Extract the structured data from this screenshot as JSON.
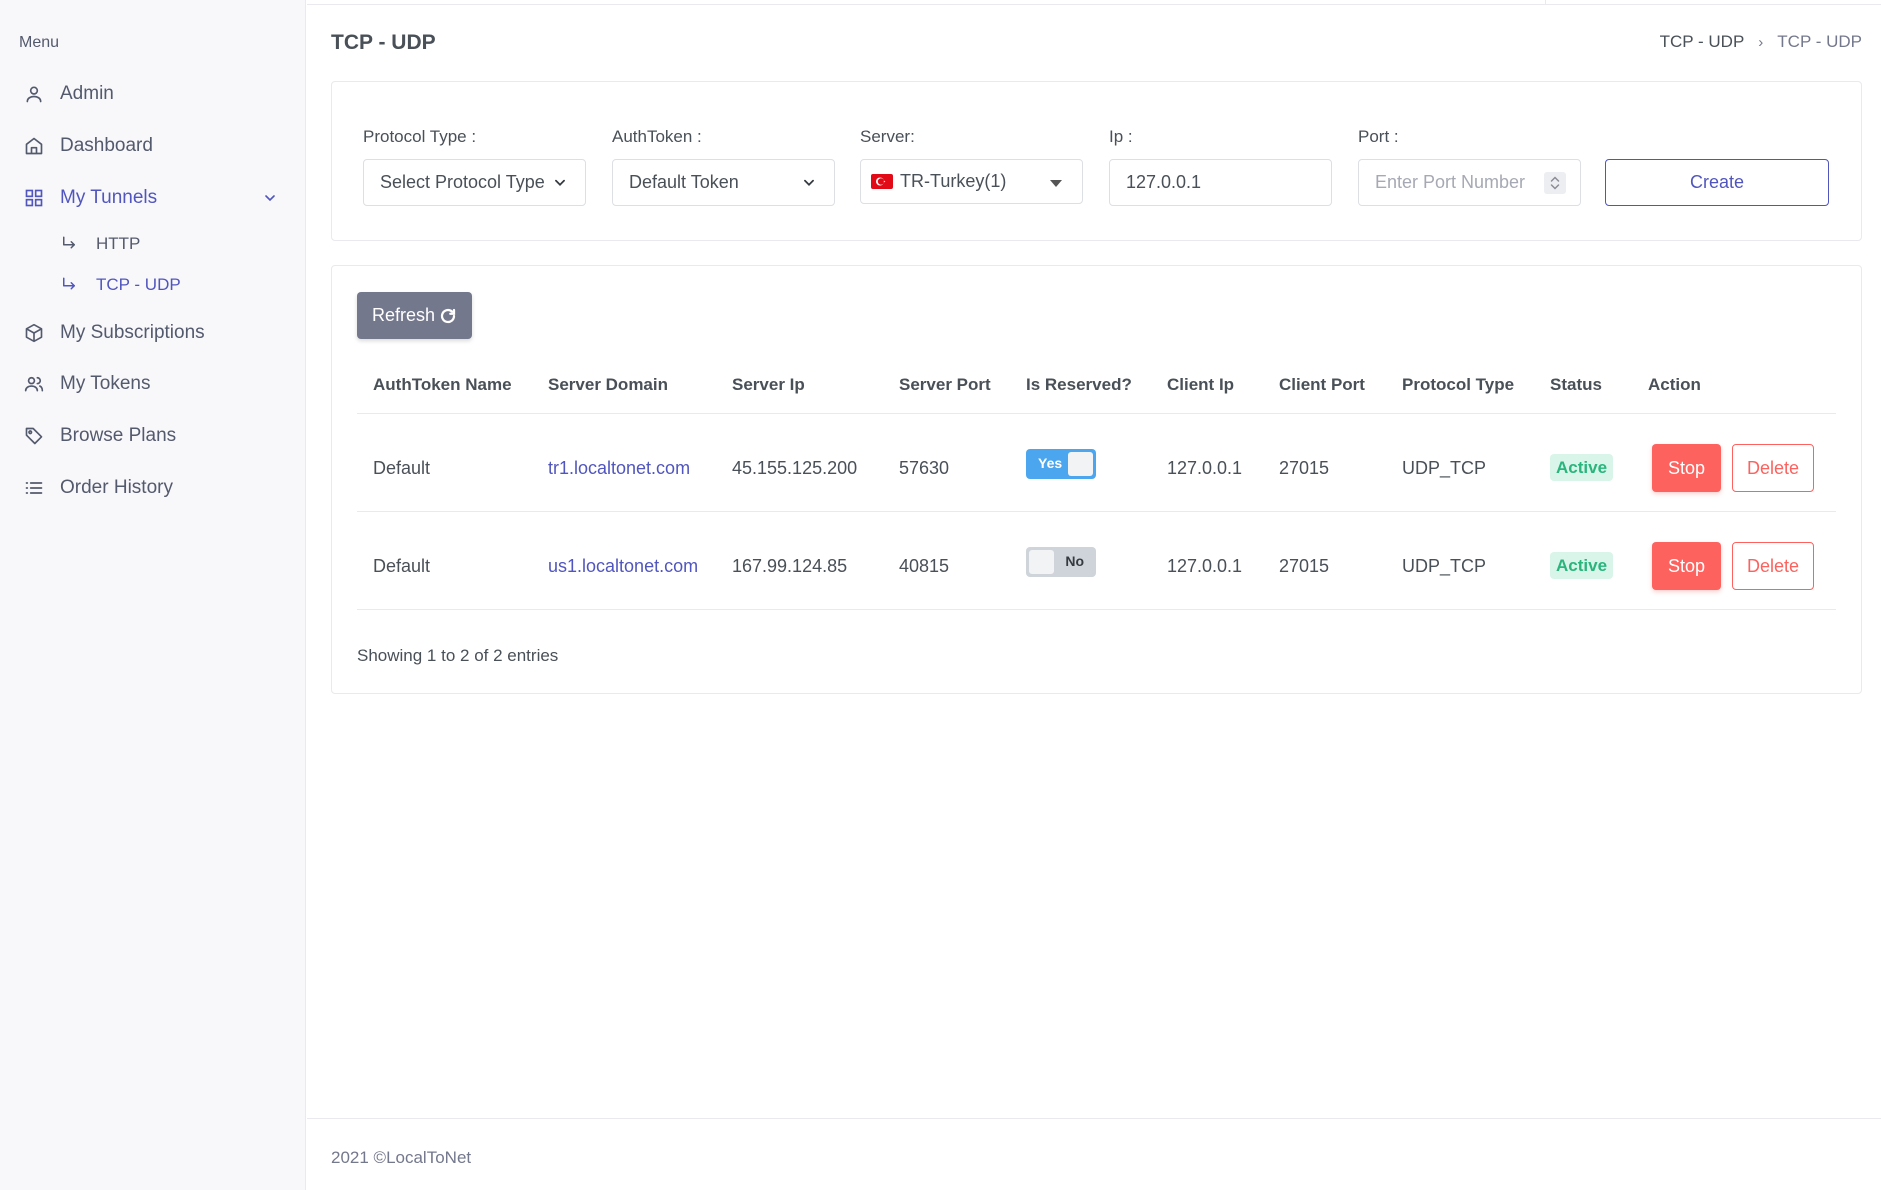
{
  "sidebar": {
    "menu_title": "Menu",
    "items": [
      {
        "label": "Admin",
        "icon": "user-icon"
      },
      {
        "label": "Dashboard",
        "icon": "home-icon"
      },
      {
        "label": "My Tunnels",
        "icon": "grid-icon"
      },
      {
        "label": "My Subscriptions",
        "icon": "box-icon"
      },
      {
        "label": "My Tokens",
        "icon": "users-icon"
      },
      {
        "label": "Browse Plans",
        "icon": "tag-icon"
      },
      {
        "label": "Order History",
        "icon": "list-icon"
      }
    ],
    "subitems": [
      {
        "label": "HTTP"
      },
      {
        "label": "TCP - UDP"
      }
    ]
  },
  "header": {
    "title": "TCP - UDP",
    "breadcrumb": [
      "TCP - UDP",
      "TCP - UDP"
    ]
  },
  "form": {
    "protocol_label": "Protocol Type :",
    "protocol_value": "Select Protocol Type",
    "authtoken_label": "AuthToken :",
    "authtoken_value": "Default Token",
    "server_label": "Server:",
    "server_value": "TR-Turkey(1)",
    "ip_label": "Ip :",
    "ip_value": "127.0.0.1",
    "port_label": "Port :",
    "port_placeholder": "Enter Port Number",
    "create_label": "Create"
  },
  "table": {
    "refresh_label": "Refresh",
    "columns": [
      "AuthToken Name",
      "Server Domain",
      "Server Ip",
      "Server Port",
      "Is Reserved?",
      "Client Ip",
      "Client Port",
      "Protocol Type",
      "Status",
      "Action"
    ],
    "rows": [
      {
        "token": "Default",
        "domain": "tr1.localtonet.com",
        "server_ip": "45.155.125.200",
        "server_port": "57630",
        "reserved": "Yes",
        "client_ip": "127.0.0.1",
        "client_port": "27015",
        "protocol": "UDP_TCP",
        "status": "Active",
        "stop": "Stop",
        "delete": "Delete"
      },
      {
        "token": "Default",
        "domain": "us1.localtonet.com",
        "server_ip": "167.99.124.85",
        "server_port": "40815",
        "reserved": "No",
        "client_ip": "127.0.0.1",
        "client_port": "27015",
        "protocol": "UDP_TCP",
        "status": "Active",
        "stop": "Stop",
        "delete": "Delete"
      }
    ],
    "entries_text": "Showing 1 to 2 of 2 entries"
  },
  "footer": {
    "text": "2021 ©LocalToNet"
  },
  "colors": {
    "accent": "#5156be",
    "danger": "#fd625e",
    "success": "#2ab57d",
    "toggle_on": "#4ba6ef"
  }
}
